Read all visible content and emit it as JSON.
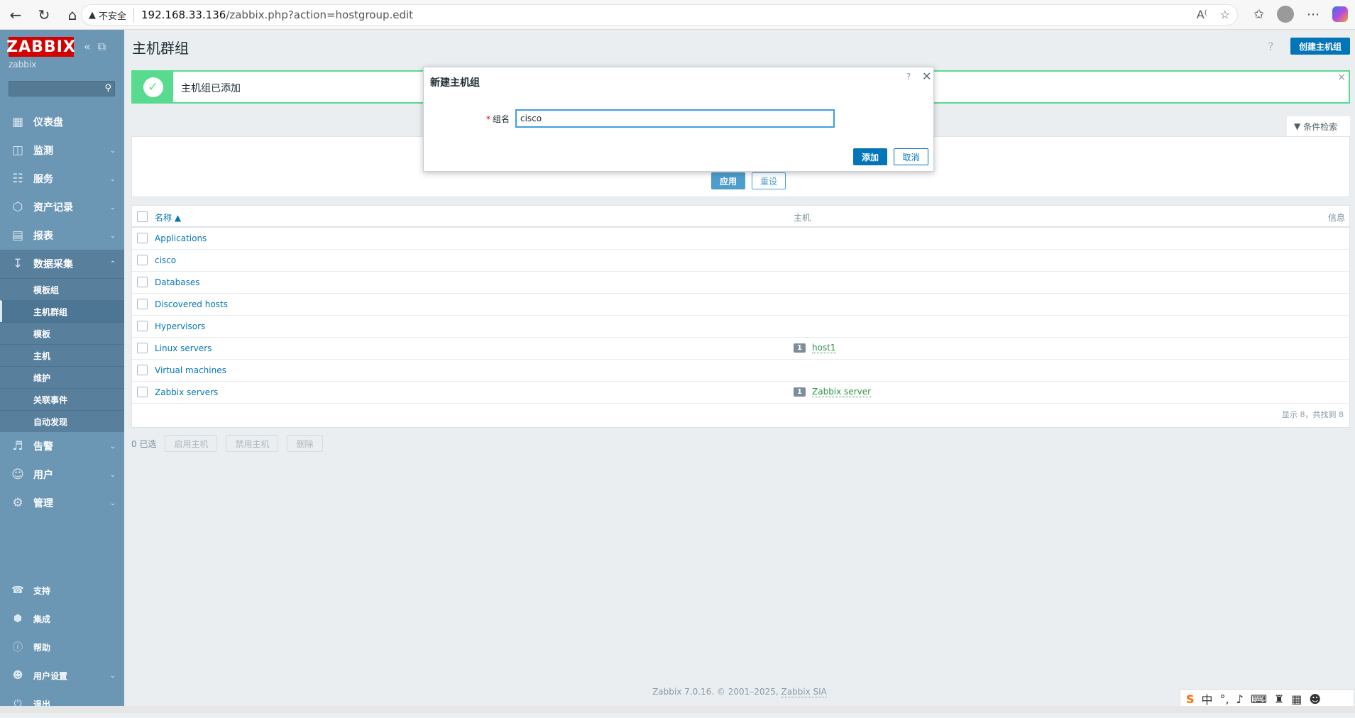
{
  "browser": {
    "insecure_label": "不安全",
    "url_host": "192.168.33.136",
    "url_path": "/zabbix.php?action=hostgroup.edit"
  },
  "sidebar": {
    "logo": "ZABBIX",
    "server_name": "zabbix",
    "menu": [
      {
        "label": "仪表盘",
        "icon": "dashboard-icon"
      },
      {
        "label": "监测",
        "icon": "monitoring-icon"
      },
      {
        "label": "服务",
        "icon": "services-icon"
      },
      {
        "label": "资产记录",
        "icon": "inventory-icon"
      },
      {
        "label": "报表",
        "icon": "reports-icon"
      },
      {
        "label": "数据采集",
        "icon": "data-collection-icon"
      }
    ],
    "submenu": [
      "模板组",
      "主机群组",
      "模板",
      "主机",
      "维护",
      "关联事件",
      "自动发现"
    ],
    "menu2": [
      {
        "label": "告警",
        "icon": "alerts-icon"
      },
      {
        "label": "用户",
        "icon": "users-icon"
      },
      {
        "label": "管理",
        "icon": "admin-icon"
      }
    ],
    "bottom": [
      {
        "label": "支持",
        "icon": "support-icon"
      },
      {
        "label": "集成",
        "icon": "integrations-icon"
      },
      {
        "label": "帮助",
        "icon": "help-icon"
      },
      {
        "label": "用户设置",
        "icon": "user-settings-icon"
      },
      {
        "label": "退出",
        "icon": "logout-icon"
      }
    ]
  },
  "header": {
    "title": "主机群组",
    "create_button": "创建主机组"
  },
  "message": {
    "text": "主机组已添加"
  },
  "filter": {
    "tab_label": "条件检索",
    "apply": "应用",
    "reset": "重设"
  },
  "table": {
    "col_name": "名称 ▲",
    "col_hosts": "主机",
    "col_info": "信息",
    "rows": [
      {
        "name": "Applications",
        "count": "",
        "host": ""
      },
      {
        "name": "cisco",
        "count": "",
        "host": ""
      },
      {
        "name": "Databases",
        "count": "",
        "host": ""
      },
      {
        "name": "Discovered hosts",
        "count": "",
        "host": ""
      },
      {
        "name": "Hypervisors",
        "count": "",
        "host": ""
      },
      {
        "name": "Linux servers",
        "count": "1",
        "host": "host1"
      },
      {
        "name": "Virtual machines",
        "count": "",
        "host": ""
      },
      {
        "name": "Zabbix servers",
        "count": "1",
        "host": "Zabbix server"
      }
    ],
    "footer": "显示 8，共找到 8"
  },
  "actions": {
    "selected": "0 已选",
    "enable": "启用主机",
    "disable": "禁用主机",
    "delete": "删除"
  },
  "footer": {
    "text": "Zabbix 7.0.16. © 2001–2025, ",
    "company": "Zabbix SIA"
  },
  "modal": {
    "title": "新建主机组",
    "field_label": "组名",
    "field_value": "cisco",
    "add": "添加",
    "cancel": "取消"
  },
  "ime": {
    "lang": "中"
  }
}
